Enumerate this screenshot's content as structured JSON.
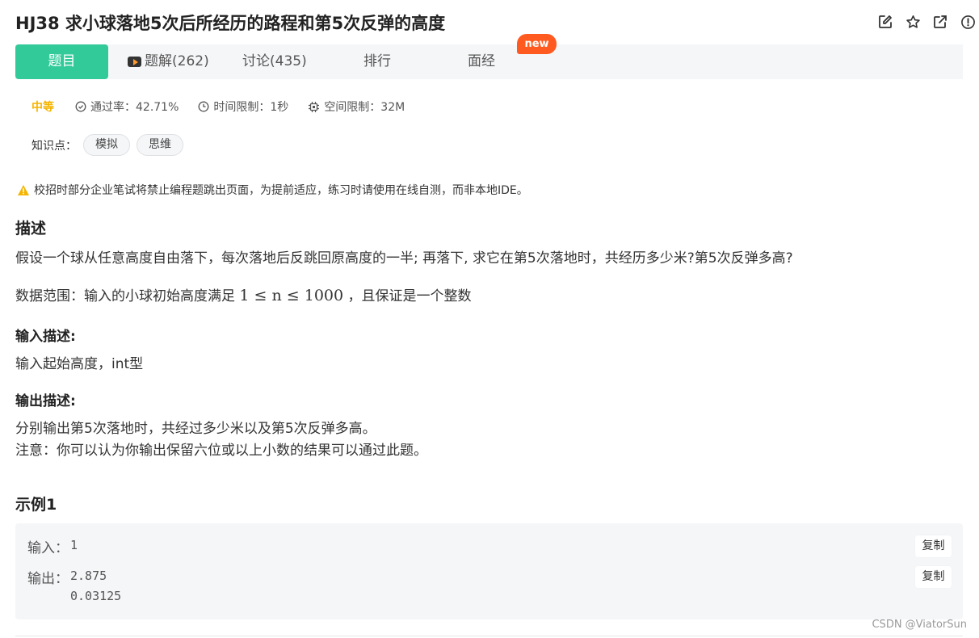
{
  "title": "HJ38  求小球落地5次后所经历的路程和第5次反弹的高度",
  "title_actions": {
    "edit": "edit-icon",
    "favorite": "star-icon",
    "share": "share-icon",
    "report": "report-icon"
  },
  "tabs": {
    "problem": "题目",
    "solutions": "题解(262)",
    "discussion": "讨论(435)",
    "ranking": "排行",
    "interview": "面经",
    "new_badge": "new"
  },
  "meta": {
    "difficulty": "中等",
    "pass_rate": "通过率：42.71%",
    "time_limit": "时间限制：1秒",
    "space_limit": "空间限制：32M"
  },
  "tags": {
    "label": "知识点：",
    "items": [
      "模拟",
      "思维"
    ]
  },
  "notice": "校招时部分企业笔试将禁止编程题跳出页面，为提前适应，练习时请使用在线自测，而非本地IDE。",
  "description": {
    "heading": "描述",
    "text": "假设一个球从任意高度自由落下，每次落地后反跳回原高度的一半; 再落下, 求它在第5次落地时，共经历多少米?第5次反弹多高?",
    "range_prefix": "数据范围：输入的小球初始高度满足 ",
    "range_math": "1 ≤ n ≤ 1000",
    "range_suffix": " ，且保证是一个整数"
  },
  "input_desc": {
    "heading": "输入描述:",
    "text": "输入起始高度，int型"
  },
  "output_desc": {
    "heading": "输出描述:",
    "line1": "分别输出第5次落地时，共经过多少米以及第5次反弹多高。",
    "line2": "注意：你可以认为你输出保留六位或以上小数的结果可以通过此题。"
  },
  "example": {
    "heading": "示例1",
    "input_label": "输入：",
    "input_value": "1",
    "output_label": "输出：",
    "output_value": "2.875\n0.03125",
    "copy_label": "复制"
  },
  "watermark": "CSDN @ViatorSun",
  "colors": {
    "accent": "#32ca99",
    "difficulty": "#f5b400",
    "badge": "#ff5a1f",
    "warning": "#f5b400"
  }
}
